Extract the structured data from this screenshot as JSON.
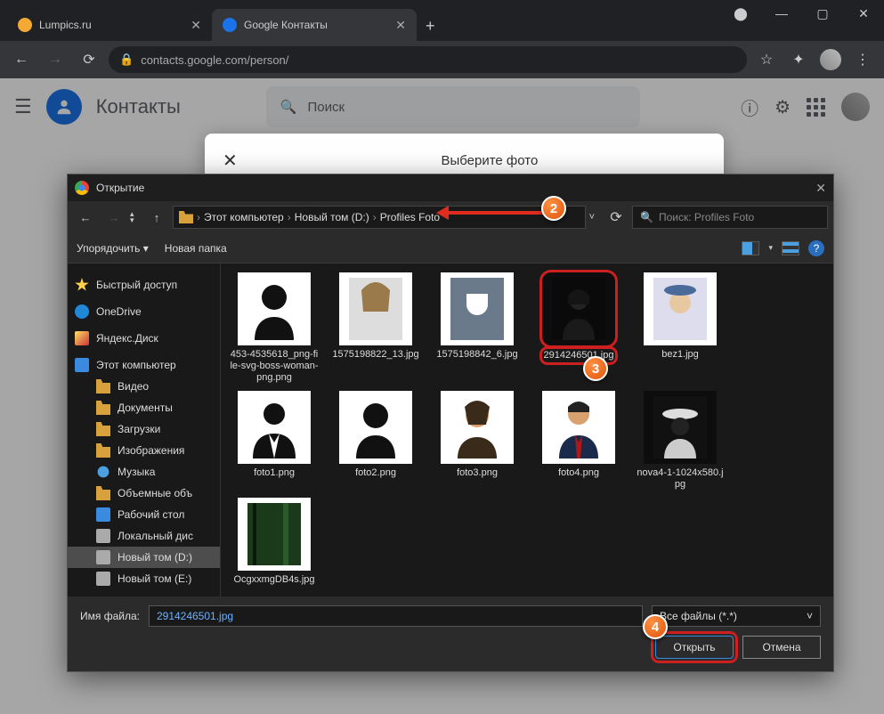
{
  "browser": {
    "tabs": [
      {
        "title": "Lumpics.ru"
      },
      {
        "title": "Google Контакты"
      }
    ],
    "url": "contacts.google.com/person/"
  },
  "gc": {
    "title": "Контакты",
    "search_placeholder": "Поиск",
    "modal_title": "Выберите фото"
  },
  "dialog": {
    "title": "Открытие",
    "breadcrumb": [
      "Этот компьютер",
      "Новый том (D:)",
      "Profiles Foto"
    ],
    "search_placeholder": "Поиск: Profiles Foto",
    "toolbar": {
      "organize": "Упорядочить",
      "new_folder": "Новая папка"
    },
    "sidebar": {
      "items": [
        {
          "label": "Быстрый доступ",
          "icon": "star",
          "group": true
        },
        {
          "label": "OneDrive",
          "icon": "cloud",
          "group": true
        },
        {
          "label": "Яндекс.Диск",
          "icon": "ydisk",
          "group": true
        },
        {
          "label": "Этот компьютер",
          "icon": "comp",
          "group": true
        },
        {
          "label": "Видео",
          "icon": "folder",
          "sub": true
        },
        {
          "label": "Документы",
          "icon": "folder",
          "sub": true
        },
        {
          "label": "Загрузки",
          "icon": "folder",
          "sub": true
        },
        {
          "label": "Изображения",
          "icon": "folder",
          "sub": true
        },
        {
          "label": "Музыка",
          "icon": "music",
          "sub": true
        },
        {
          "label": "Объемные объ",
          "icon": "folder",
          "sub": true
        },
        {
          "label": "Рабочий стол",
          "icon": "desktop",
          "sub": true
        },
        {
          "label": "Локальный дис",
          "icon": "disk",
          "sub": true
        },
        {
          "label": "Новый том (D:)",
          "icon": "disk",
          "sub": true,
          "selected": true
        },
        {
          "label": "Новый том (E:)",
          "icon": "disk",
          "sub": true
        }
      ]
    },
    "files": [
      {
        "name": "453-4535618_png-file-svg-boss-woman-png.png"
      },
      {
        "name": "1575198822_13.jpg"
      },
      {
        "name": "1575198842_6.jpg"
      },
      {
        "name": "2914246501.jpg",
        "selected": true
      },
      {
        "name": "bez1.jpg"
      },
      {
        "name": "foto1.png"
      },
      {
        "name": "foto2.png"
      },
      {
        "name": "foto3.png"
      },
      {
        "name": "foto4.png"
      },
      {
        "name": "nova4-1-1024x580.jpg"
      },
      {
        "name": "OcgxxmgDB4s.jpg"
      }
    ],
    "filename_label": "Имя файла:",
    "filename_value": "2914246501.jpg",
    "filetype": "Все файлы (*.*)",
    "open": "Открыть",
    "cancel": "Отмена"
  },
  "badges": {
    "b2": "2",
    "b3": "3",
    "b4": "4"
  }
}
